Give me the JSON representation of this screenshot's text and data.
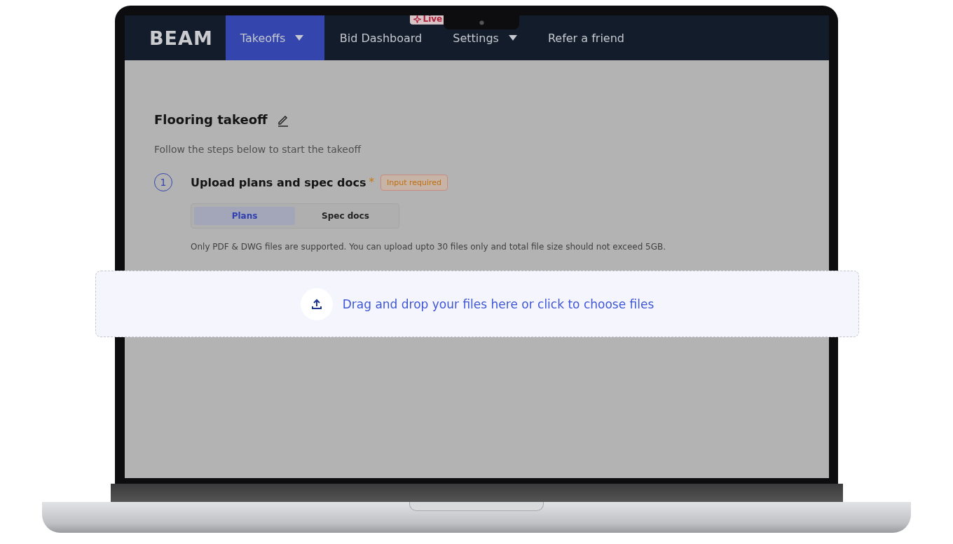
{
  "nav": {
    "logo": "BEAM",
    "items": [
      {
        "label": "Takeoffs",
        "selected": true,
        "dropdown": true
      },
      {
        "label": "Bid Dashboard",
        "selected": false,
        "dropdown": false,
        "badge": "Live"
      },
      {
        "label": "Settings",
        "selected": false,
        "dropdown": true
      },
      {
        "label": "Refer a friend",
        "selected": false,
        "dropdown": false
      }
    ]
  },
  "page": {
    "title": "Flooring takeoff",
    "subtitle": "Follow the steps below to start the takeoff"
  },
  "step": {
    "number": "1",
    "title": "Upload plans and spec docs",
    "required_mark": "*",
    "badge": "Input required",
    "tabs": [
      {
        "label": "Plans",
        "selected": true
      },
      {
        "label": "Spec docs",
        "selected": false
      }
    ],
    "note": "Only PDF & DWG files are supported. You can upload upto 30 files only and total file size should not exceed 5GB."
  },
  "dropzone": {
    "text": "Drag and drop your files here or click to choose files"
  }
}
